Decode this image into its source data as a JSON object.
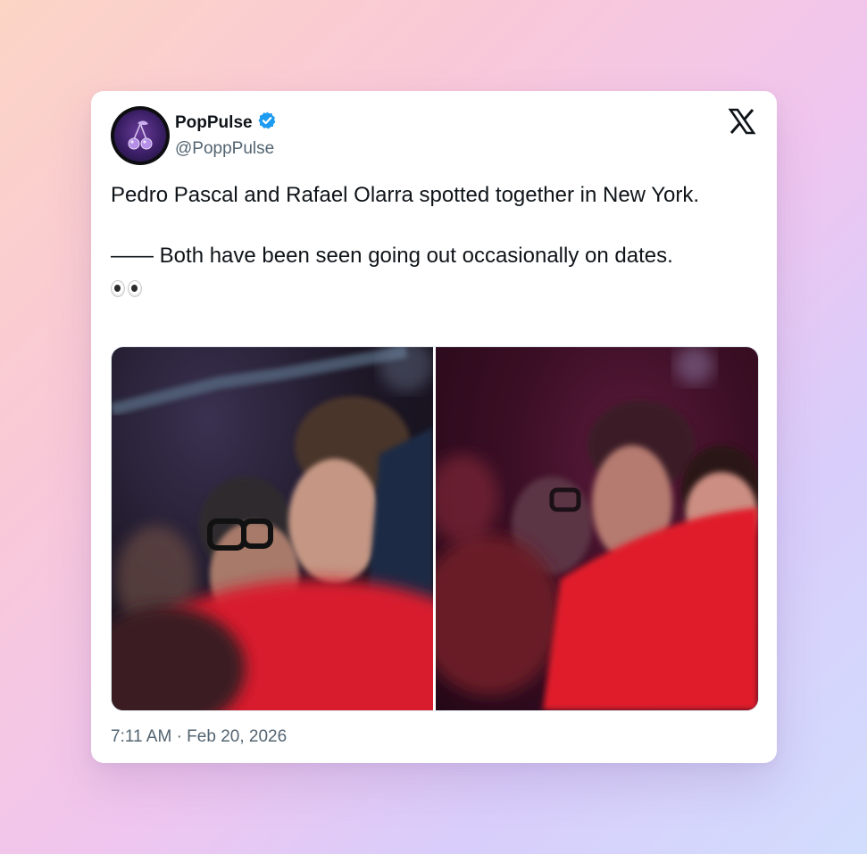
{
  "tweet": {
    "author": {
      "display_name": "PopPulse",
      "handle": "@PoppPulse",
      "verified": true,
      "verified_color": "#1d9bf0",
      "avatar_icon": "cherry-icon"
    },
    "platform_icon": "x-logo-icon",
    "text": {
      "line1": "Pedro Pascal and Rafael Olarra spotted together in New York.",
      "line2": "—— Both have been seen going out occasionally on dates.",
      "emoji": "eyes-emoji"
    },
    "media": {
      "count": 2,
      "items": [
        {
          "name": "photo-left"
        },
        {
          "name": "photo-right"
        }
      ]
    },
    "timestamp": "7:11 AM · Feb 20, 2026"
  },
  "colors": {
    "text_primary": "#0f1419",
    "text_secondary": "#536471",
    "card_background": "#ffffff"
  }
}
